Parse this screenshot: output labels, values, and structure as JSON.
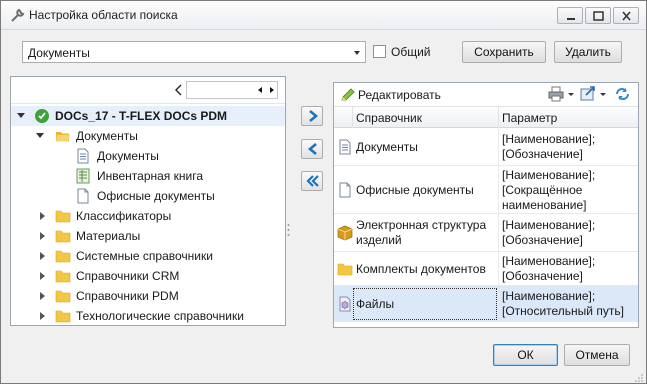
{
  "window": {
    "title": "Настройка области поиска",
    "icon": "wrench-icon"
  },
  "top": {
    "scope_value": "Документы",
    "common_label": "Общий",
    "common_checked": false,
    "save_label": "Сохранить",
    "delete_label": "Удалить"
  },
  "tree": {
    "root_label": "DOCs_17 - T-FLEX DOCs PDM",
    "items": [
      {
        "label": "Документы",
        "level": 1,
        "expanded": true,
        "icon": "folder-open-icon"
      },
      {
        "label": "Документы",
        "level": 2,
        "icon": "document-list-icon"
      },
      {
        "label": "Инвентарная книга",
        "level": 2,
        "icon": "ledger-icon"
      },
      {
        "label": "Офисные документы",
        "level": 2,
        "icon": "blank-document-icon"
      },
      {
        "label": "Классификаторы",
        "level": 1,
        "expanded": false,
        "icon": "folder-icon"
      },
      {
        "label": "Материалы",
        "level": 1,
        "expanded": false,
        "icon": "folder-icon"
      },
      {
        "label": "Системные справочники",
        "level": 1,
        "expanded": false,
        "icon": "folder-icon"
      },
      {
        "label": "Справочники CRM",
        "level": 1,
        "expanded": false,
        "icon": "folder-icon"
      },
      {
        "label": "Справочники PDM",
        "level": 1,
        "expanded": false,
        "icon": "folder-icon"
      },
      {
        "label": "Технологические справочники",
        "level": 1,
        "expanded": false,
        "icon": "folder-icon"
      }
    ]
  },
  "right": {
    "edit_label": "Редактировать",
    "columns": [
      "Справочник",
      "Параметр"
    ],
    "rows": [
      {
        "name": "Документы",
        "param": "[Наименование];\n[Обозначение]",
        "icon": "document-list-icon"
      },
      {
        "name": "Офисные документы",
        "param": "[Наименование];\n[Сокращённое\nнаименование]",
        "icon": "blank-document-icon"
      },
      {
        "name": "Электронная структура\nизделий",
        "param": "[Наименование];\n[Обозначение]",
        "icon": "structure-box-icon"
      },
      {
        "name": "Комплекты документов",
        "param": "[Наименование];\n[Обозначение]",
        "icon": "folder-icon"
      },
      {
        "name": "Файлы",
        "param": "[Наименование];\n[Относительный путь]",
        "icon": "file-cube-icon",
        "selected": true
      }
    ]
  },
  "footer": {
    "ok_label": "ОК",
    "cancel_label": "Отмена"
  },
  "colors": {
    "accent": "#1e73be",
    "selection": "#dbe8f8",
    "folder": "#f2c744"
  }
}
